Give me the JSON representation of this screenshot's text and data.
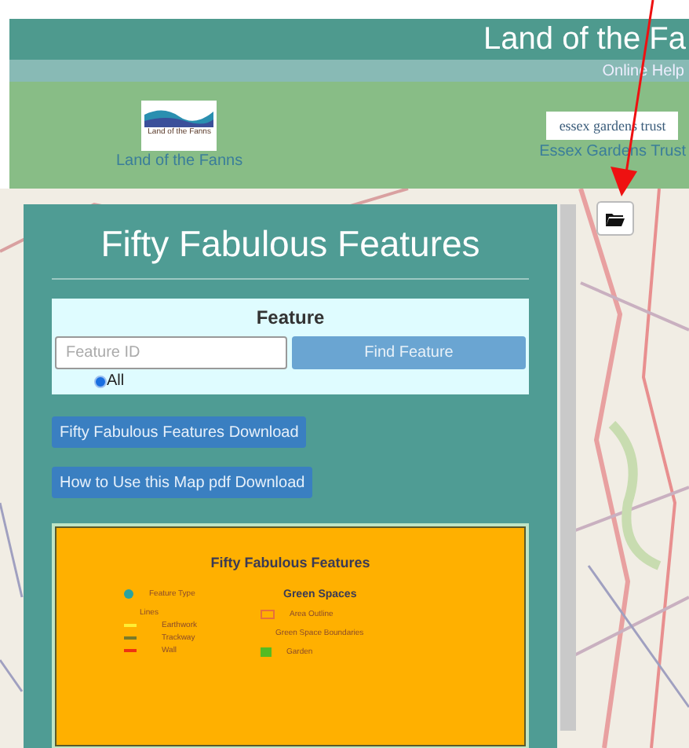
{
  "header": {
    "title": "Land of the Fa"
  },
  "help_bar": {
    "link": "Online Help"
  },
  "partners": [
    {
      "kind": "fanns",
      "logo_text": "Land of the Fanns",
      "caption": "Land of the Fanns"
    },
    {
      "kind": "essex",
      "logo_text": "essex gardens trust",
      "caption": "Essex Gardens Trust"
    }
  ],
  "panel": {
    "title": "Fifty Fabulous Features",
    "feature_search": {
      "heading": "Feature",
      "placeholder": "Feature ID",
      "button": "Find Feature",
      "radios": [
        {
          "label": "All",
          "selected": true
        }
      ]
    },
    "downloads": [
      "Fifty Fabulous Features Download",
      "How to Use this Map pdf Download"
    ],
    "legend": {
      "title": "Fifty Fabulous Features",
      "left": [
        {
          "kind": "dot",
          "label": "Feature Type",
          "color": "#2aa3a0"
        },
        {
          "kind": "heading",
          "label": "Lines"
        },
        {
          "kind": "line",
          "label": "Earthwork",
          "color": "#ffee33"
        },
        {
          "kind": "line",
          "label": "Trackway",
          "color": "#7a7a2a"
        },
        {
          "kind": "line",
          "label": "Wall",
          "color": "#ee3311"
        }
      ],
      "right": [
        {
          "kind": "title",
          "label": "Green Spaces"
        },
        {
          "kind": "outline",
          "label": "Area Outline",
          "color": "#e8703a"
        },
        {
          "kind": "heading",
          "label": "Green Space Boundaries"
        },
        {
          "kind": "fill",
          "label": "Garden",
          "color": "#55bb22"
        }
      ]
    }
  }
}
